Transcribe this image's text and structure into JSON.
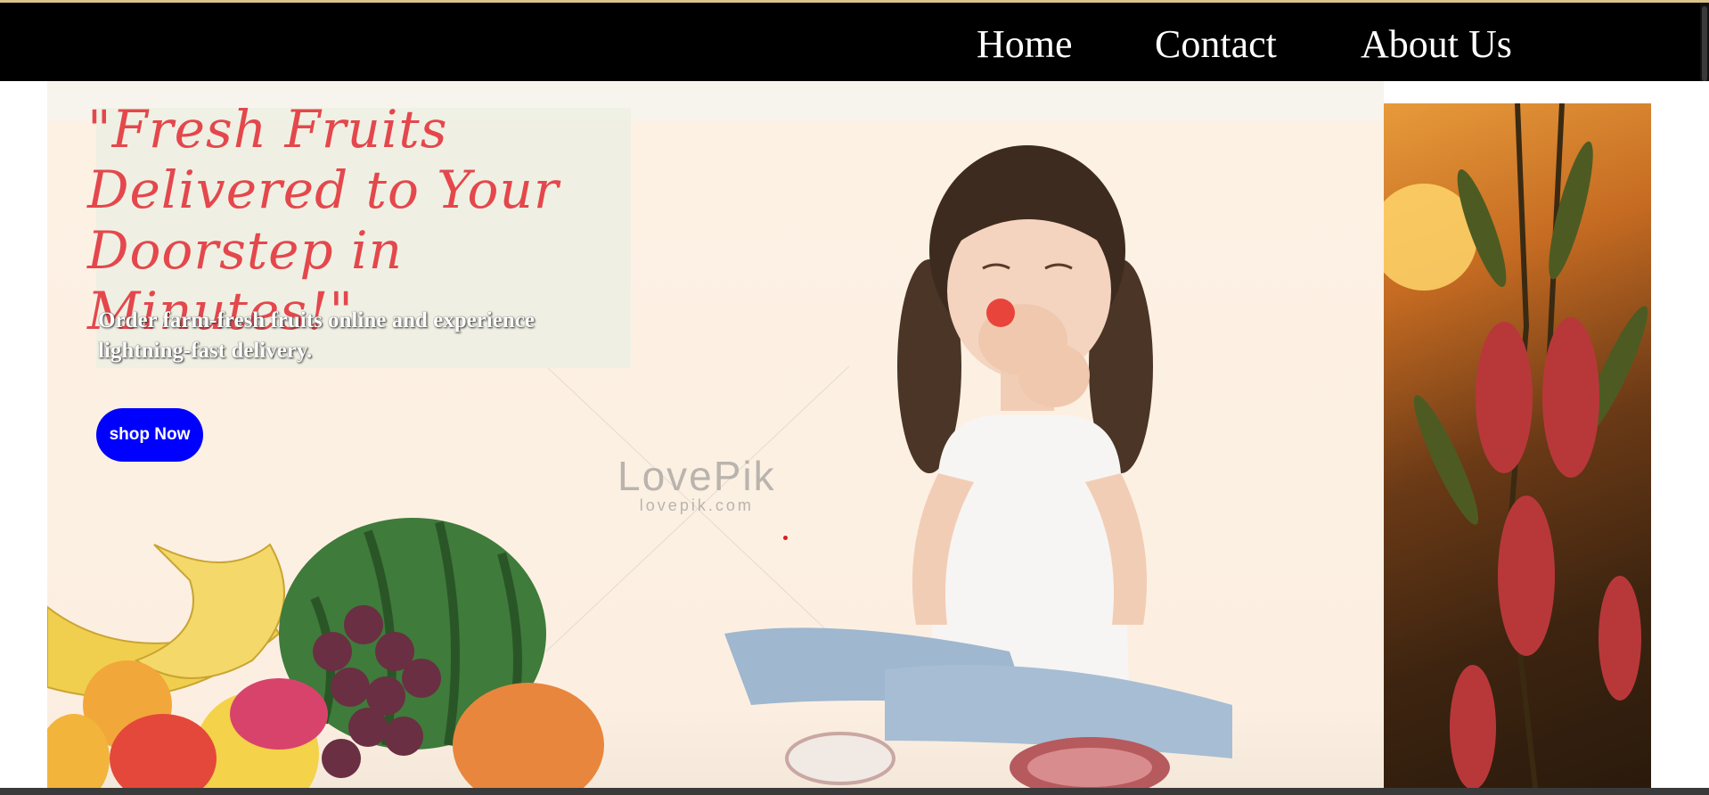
{
  "nav": {
    "links": [
      "Home",
      "Contact",
      "About Us"
    ]
  },
  "hero": {
    "headline": "\"Fresh Fruits Delivered to Your Doorstep in Minutes!\"",
    "subtext": "Order farm-fresh fruits online and experience lightning-fast delivery.",
    "cta_label": "shop Now",
    "watermark_logo": "LovePik",
    "watermark_url": "lovepik.com"
  },
  "colors": {
    "nav_background": "#000000",
    "headline": "#e4474c",
    "cta_background": "#0000ff"
  }
}
